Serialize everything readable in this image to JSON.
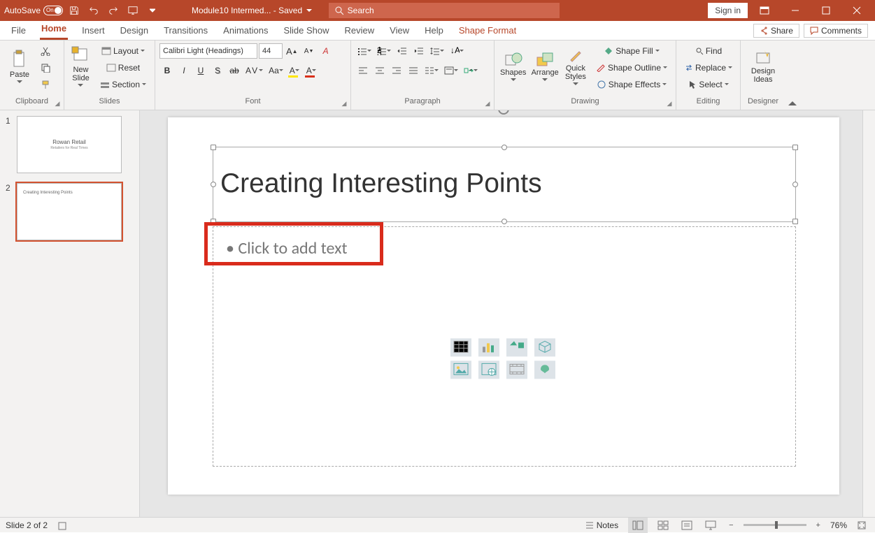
{
  "titlebar": {
    "autosave": "AutoSave",
    "autosave_state": "On",
    "doc": "Module10 Intermed...",
    "saved": "- Saved",
    "search_ph": "Search",
    "signin": "Sign in"
  },
  "tabs": {
    "file": "File",
    "home": "Home",
    "insert": "Insert",
    "design": "Design",
    "transitions": "Transitions",
    "animations": "Animations",
    "slideshow": "Slide Show",
    "review": "Review",
    "view": "View",
    "help": "Help",
    "shapefmt": "Shape Format",
    "share": "Share",
    "comments": "Comments"
  },
  "ribbon": {
    "clipboard": {
      "label": "Clipboard",
      "paste": "Paste"
    },
    "slides": {
      "label": "Slides",
      "new": "New\nSlide",
      "layout": "Layout",
      "reset": "Reset",
      "section": "Section"
    },
    "font": {
      "label": "Font",
      "name": "Calibri Light (Headings)",
      "size": "44"
    },
    "paragraph": {
      "label": "Paragraph"
    },
    "drawing": {
      "label": "Drawing",
      "shapes": "Shapes",
      "arrange": "Arrange",
      "quick": "Quick\nStyles",
      "fill": "Shape Fill",
      "outline": "Shape Outline",
      "effects": "Shape Effects"
    },
    "editing": {
      "label": "Editing",
      "find": "Find",
      "replace": "Replace",
      "select": "Select"
    },
    "designer": {
      "label": "Designer",
      "ideas": "Design\nIdeas"
    }
  },
  "thumbs": {
    "n1": "1",
    "n2": "2",
    "s1a": "Rowan Retail",
    "s1b": "Retailers for Real Times",
    "s2a": "Creating Interesting Points"
  },
  "slide": {
    "title": "Creating Interesting Points",
    "body": "• Click to add text"
  },
  "status": {
    "slide": "Slide 2 of 2",
    "notes": "Notes",
    "zoom": "76%"
  }
}
